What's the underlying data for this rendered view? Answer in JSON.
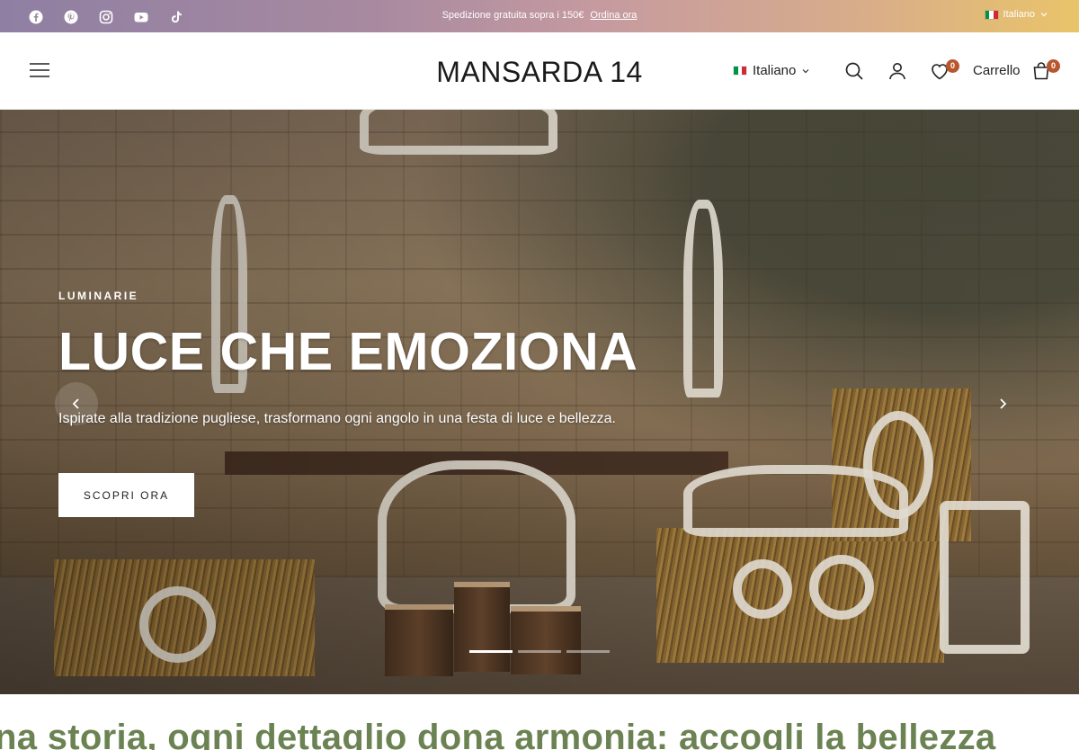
{
  "announcement": {
    "text": "Spedizione gratuita sopra i 150€",
    "link": "Ordina ora",
    "language": "Italiano",
    "socials": [
      "facebook-icon",
      "pinterest-icon",
      "instagram-icon",
      "youtube-icon",
      "tiktok-icon"
    ]
  },
  "header": {
    "brand": "MANSARDA 14",
    "language": "Italiano",
    "wishlist_count": "0",
    "cart_label": "Carrello",
    "cart_count": "0"
  },
  "hero": {
    "eyebrow": "LUMINARIE",
    "headline": "LUCE CHE EMOZIONA",
    "subtitle": "Ispirate alla tradizione pugliese, trasformano ogni angolo in una festa di luce e bellezza.",
    "cta": "SCOPRI ORA",
    "slide_count": 3,
    "active_slide": 1
  },
  "marquee": {
    "text": "na storia, ogni dettaglio dona armonia: accogli la bellezza"
  },
  "colors": {
    "accent": "#b8572f",
    "marquee_green": "#6b8252",
    "topbar_start": "#8f7fa3",
    "topbar_end": "#e9c46a"
  }
}
